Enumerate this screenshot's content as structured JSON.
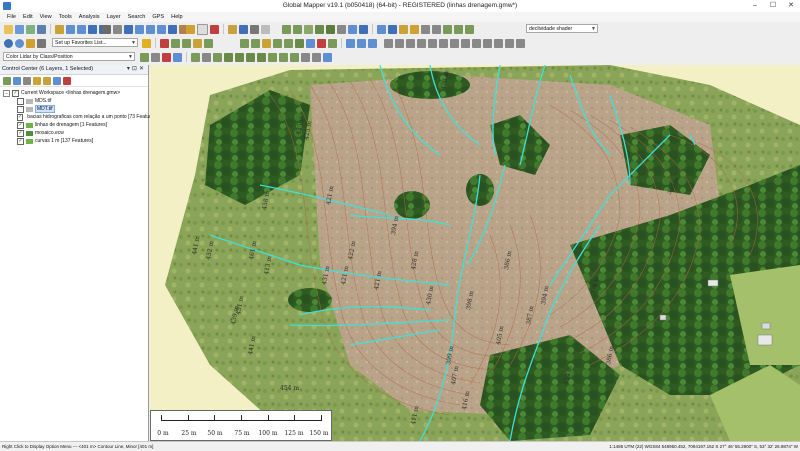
{
  "window": {
    "title": "Global Mapper v19.1 (b050418) (64-bit) - REGISTERED (linhas drenagem.gmw*)",
    "minimize": "–",
    "maximize": "☐",
    "close": "✕"
  },
  "menu": [
    "File",
    "Edit",
    "View",
    "Tools",
    "Analysis",
    "Layer",
    "Search",
    "GPS",
    "Help"
  ],
  "toolbar": {
    "shader": "declividade shader",
    "favorites": "Set up Favorites List...",
    "color_by": "Color Lidar by Class/Position"
  },
  "control_center": {
    "title": "Control Center (6 Layers, 1 Selected)",
    "workspace": "Current Workspace <linhas drenagem.gmw>",
    "layers": [
      {
        "label": "MDS.tif",
        "checked": false
      },
      {
        "label": "MDT.tif",
        "checked": false,
        "selected": true
      },
      {
        "label": "bacias hidrograficas com relação a um ponto [73 Features]",
        "checked": true
      },
      {
        "label": "linhas de drenagem [1 Features]",
        "checked": true
      },
      {
        "label": "mosaico.ecw",
        "checked": true
      },
      {
        "label": "curvas 1 m [137 Features]",
        "checked": true
      }
    ]
  },
  "map": {
    "contour_labels": [
      "425 m",
      "421 m",
      "435 m",
      "458 m",
      "461 m",
      "441 m",
      "452 m",
      "421 m",
      "422 m",
      "431 m",
      "451 m",
      "421 m",
      "428 m",
      "386 m",
      "398 m",
      "405 m",
      "394 m",
      "387 m",
      "407 m",
      "416 m",
      "411 m",
      "434 m",
      "356 m",
      "394 m",
      "413 m",
      "430 m",
      "399 m",
      "376 m",
      "386 m",
      "454 m",
      "441 m",
      "439 m",
      "420 m"
    ]
  },
  "scale": {
    "labels": [
      "0 m",
      "25 m",
      "50 m",
      "75 m",
      "100 m",
      "125 m",
      "150 m"
    ]
  },
  "status": {
    "left": "Right Click to Display Option Menu --- <401 m> Contour Line, Minor [401 m]",
    "right": "1:1486   UTM (22)   WGS84   548950.452, 7094197.152 S   27° 46' 55.2900\" S, 53° 32' 26.9874\" W"
  },
  "colors": {
    "accent": "#3a76c8",
    "drainage": "#3fe0d8",
    "contour": "#b26a46",
    "background": "#f4f0c6"
  }
}
